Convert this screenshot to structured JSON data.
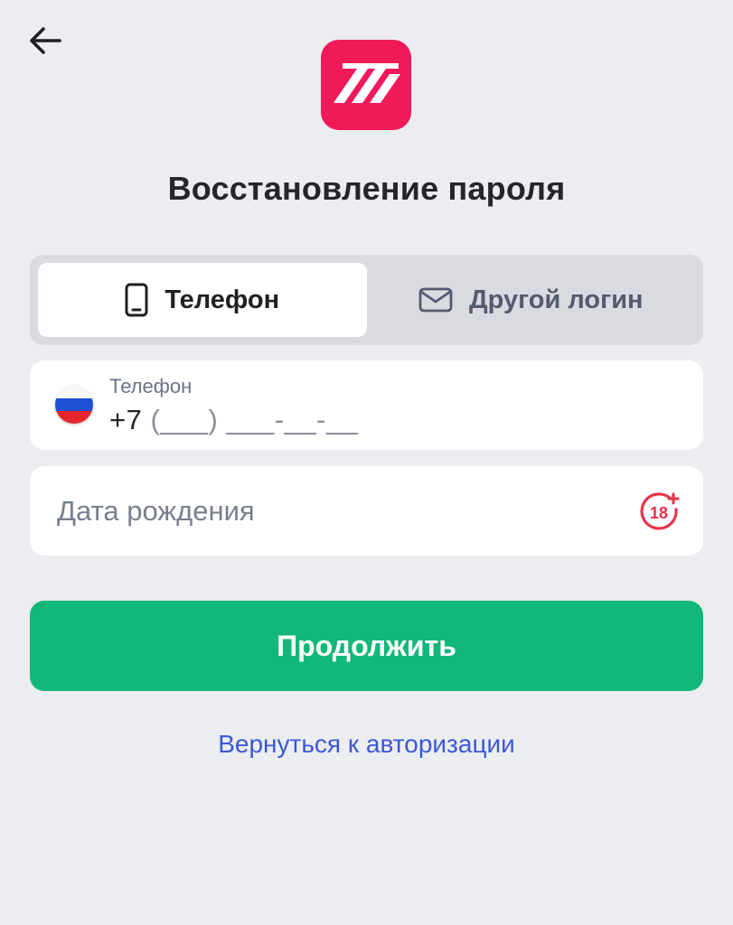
{
  "header": {
    "back_icon": "arrow-left-icon",
    "logo_icon": "brand-logo-m"
  },
  "title": "Восстановление пароля",
  "tabs": [
    {
      "label": "Телефон",
      "icon": "phone-icon",
      "active": true
    },
    {
      "label": "Другой логин",
      "icon": "mail-icon",
      "active": false
    }
  ],
  "phone_field": {
    "label": "Телефон",
    "country_code": "+7",
    "mask": "(___) ___-__-__",
    "flag": "russia-flag-icon"
  },
  "dob_field": {
    "placeholder": "Дата рождения",
    "badge_icon": "age-18-plus-icon"
  },
  "continue_button": {
    "label": "Продолжить"
  },
  "back_link": {
    "label": "Вернуться к авторизации"
  },
  "colors": {
    "background": "#ecedf1",
    "brand": "#f0195a",
    "primary_button": "#12b77a",
    "link": "#3b58d6",
    "age_badge": "#e8324a"
  }
}
